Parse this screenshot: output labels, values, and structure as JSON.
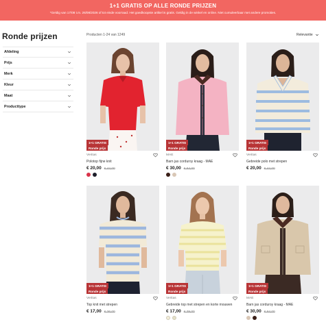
{
  "promo": {
    "title": "1+1 GRATIS OP ALLE RONDE PRIJZEN",
    "subtitle": "*Geldig van 17/08 t.m. 26/08/2026 of tot einde voorraad. Het goedkoopste artikel is gratis. Geldig in de winkel en online. Niet cumuleerbaar met andere promoties."
  },
  "page": {
    "title": "Ronde prijzen"
  },
  "filters": [
    "Afdeling",
    "Prijs",
    "Merk",
    "Kleur",
    "Maat",
    "Producttype"
  ],
  "results": {
    "count": "Producten 1-24 van 1249",
    "sort": "Relevantie"
  },
  "badge": {
    "line1": "1+1 GRATIS",
    "line2": "Ronde prijs"
  },
  "products": [
    {
      "brand": "Veritas",
      "name": "Polotop fijne knit",
      "price": "€ 20,00",
      "old": "€ 44,00",
      "swatches": [
        "#d9334a",
        "#1e1f2b"
      ]
    },
    {
      "brand": "MAE",
      "name": "Barn jas corduroy kraag - MAE",
      "price": "€ 30,00",
      "old": "€ 64,00",
      "swatches": [
        "#3a1f18",
        "#d9c7b6"
      ]
    },
    {
      "brand": "Veritas",
      "name": "Gebreide polo met strepen",
      "price": "€ 20,00",
      "old": "€ 44,00",
      "swatches": []
    },
    {
      "brand": "Veritas",
      "name": "Top knit met strepen",
      "price": "€ 17,00",
      "old": "€ 36,00",
      "swatches": []
    },
    {
      "brand": "Veritas",
      "name": "Gebreide top met strepen en korte mouwen",
      "price": "€ 17,00",
      "old": "€ 39,00",
      "swatches": [
        "#f2ecd8",
        "#e4e0c8"
      ]
    },
    {
      "brand": "MAE",
      "name": "Barn jas corduroy kraag - MAE",
      "price": "€ 30,00",
      "old": "€ 64,00",
      "swatches": [
        "#d9c7b6",
        "#3a1f18"
      ]
    }
  ],
  "colors": {
    "promo": "#f26661",
    "badge": "#b83436",
    "photo_bg": "#e9e9ea"
  },
  "icons": {
    "filter_chevron": "chevron-down-icon",
    "sort_chevron": "chevron-down-icon",
    "favorite": "heart-icon"
  }
}
